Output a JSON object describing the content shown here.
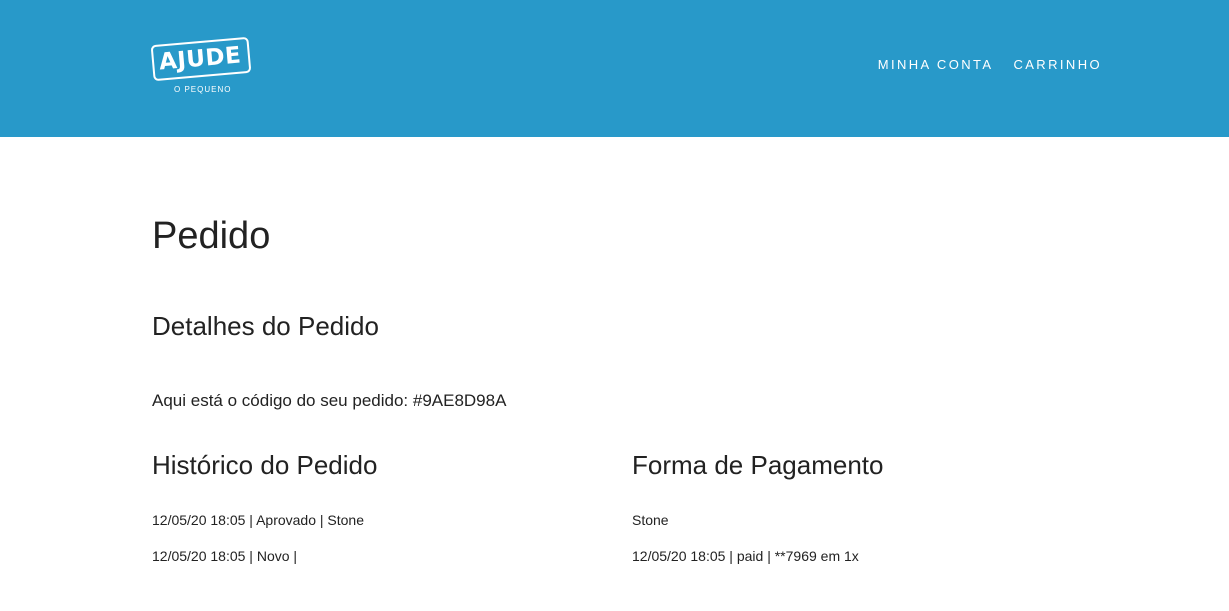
{
  "header": {
    "logo_text": "AJUDE",
    "logo_subtitle": "O PEQUENO",
    "nav": {
      "account": "MINHA CONTA",
      "cart": "CARRINHO"
    },
    "colors": {
      "background": "#2899c9",
      "text": "#ffffff"
    }
  },
  "main": {
    "title": "Pedido",
    "details": {
      "title": "Detalhes do Pedido",
      "code_text": "Aqui está o código do seu pedido: #9AE8D98A"
    },
    "history": {
      "title": "Histórico do Pedido",
      "entries": [
        "12/05/20 18:05 | Aprovado | Stone",
        "12/05/20 18:05 | Novo |"
      ]
    },
    "payment": {
      "title": "Forma de Pagamento",
      "method": "Stone",
      "details": "12/05/20 18:05 | paid | **7969 em 1x"
    }
  }
}
